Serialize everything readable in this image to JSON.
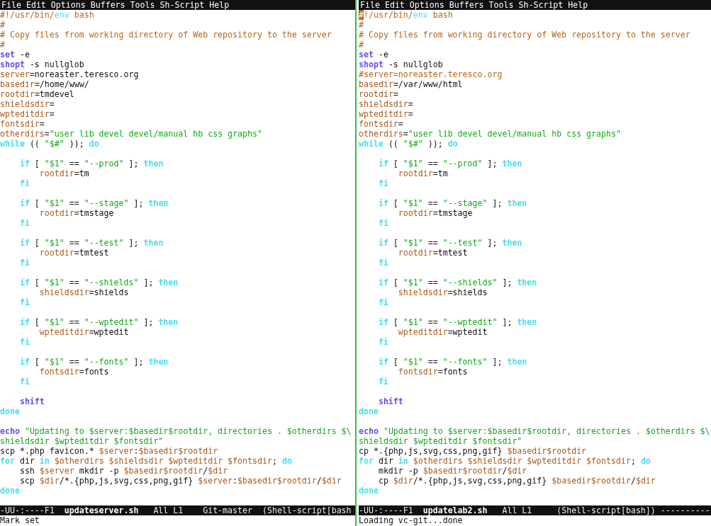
{
  "panes": [
    {
      "menu": [
        "File",
        "Edit",
        "Options",
        "Buffers",
        "Tools",
        "Sh-Script",
        "Help"
      ],
      "lines": [
        {
          "kind": "flush",
          "tokens": [
            {
              "kind": "comment",
              "text": "#!/usr/bin/"
            },
            {
              "kind": "function",
              "text": "env"
            },
            {
              "kind": "comment",
              "text": " bash"
            }
          ]
        },
        {
          "kind": "flush",
          "tokens": [
            {
              "kind": "comment",
              "text": "#"
            }
          ]
        },
        {
          "kind": "flush",
          "tokens": [
            {
              "kind": "comment",
              "text": "# Copy files from working directory of Web repository to the server"
            }
          ]
        },
        {
          "kind": "flush",
          "tokens": [
            {
              "kind": "comment",
              "text": "#"
            }
          ]
        },
        {
          "kind": "flush",
          "tokens": [
            {
              "kind": "builtin",
              "text": "set"
            },
            {
              "kind": "plain",
              "text": " -e"
            }
          ]
        },
        {
          "kind": "flush",
          "tokens": [
            {
              "kind": "builtin",
              "text": "shopt"
            },
            {
              "kind": "plain",
              "text": " -s nullglob"
            }
          ]
        },
        {
          "kind": "flush",
          "tokens": [
            {
              "kind": "variable",
              "text": "server"
            },
            {
              "kind": "plain",
              "text": "=noreaster.teresco.org"
            }
          ]
        },
        {
          "kind": "flush",
          "tokens": [
            {
              "kind": "variable",
              "text": "basedir"
            },
            {
              "kind": "plain",
              "text": "=/home/www/"
            }
          ]
        },
        {
          "kind": "flush",
          "tokens": [
            {
              "kind": "variable",
              "text": "rootdir"
            },
            {
              "kind": "plain",
              "text": "=tmdevel"
            }
          ]
        },
        {
          "kind": "flush",
          "tokens": [
            {
              "kind": "variable",
              "text": "shieldsdir"
            },
            {
              "kind": "plain",
              "text": "="
            }
          ]
        },
        {
          "kind": "flush",
          "tokens": [
            {
              "kind": "variable",
              "text": "wpteditdir"
            },
            {
              "kind": "plain",
              "text": "="
            }
          ]
        },
        {
          "kind": "flush",
          "tokens": [
            {
              "kind": "variable",
              "text": "fontsdir"
            },
            {
              "kind": "plain",
              "text": "="
            }
          ]
        },
        {
          "kind": "flush",
          "tokens": [
            {
              "kind": "variable",
              "text": "otherdirs"
            },
            {
              "kind": "plain",
              "text": "="
            },
            {
              "kind": "string",
              "text": "\"user lib devel devel/manual hb css graphs\""
            }
          ]
        },
        {
          "kind": "flush",
          "tokens": [
            {
              "kind": "keyword",
              "text": "while"
            },
            {
              "kind": "plain",
              "text": " (( "
            },
            {
              "kind": "string",
              "text": "\"$#\""
            },
            {
              "kind": "plain",
              "text": " )); "
            },
            {
              "kind": "keyword",
              "text": "do"
            }
          ]
        },
        {
          "kind": "blank"
        },
        {
          "kind": "inner",
          "tokens": [
            {
              "kind": "keyword",
              "text": "if"
            },
            {
              "kind": "plain",
              "text": " [ "
            },
            {
              "kind": "string",
              "text": "\"$1\""
            },
            {
              "kind": "plain",
              "text": " == "
            },
            {
              "kind": "string",
              "text": "\"--prod\""
            },
            {
              "kind": "plain",
              "text": " ]; "
            },
            {
              "kind": "keyword",
              "text": "then"
            }
          ]
        },
        {
          "kind": "deep",
          "tokens": [
            {
              "kind": "variable",
              "text": "rootdir"
            },
            {
              "kind": "plain",
              "text": "=tm"
            }
          ]
        },
        {
          "kind": "inner",
          "tokens": [
            {
              "kind": "keyword",
              "text": "fi"
            }
          ]
        },
        {
          "kind": "blank"
        },
        {
          "kind": "inner",
          "tokens": [
            {
              "kind": "keyword",
              "text": "if"
            },
            {
              "kind": "plain",
              "text": " [ "
            },
            {
              "kind": "string",
              "text": "\"$1\""
            },
            {
              "kind": "plain",
              "text": " == "
            },
            {
              "kind": "string",
              "text": "\"--stage\""
            },
            {
              "kind": "plain",
              "text": " ]; "
            },
            {
              "kind": "keyword",
              "text": "then"
            }
          ]
        },
        {
          "kind": "deep",
          "tokens": [
            {
              "kind": "variable",
              "text": "rootdir"
            },
            {
              "kind": "plain",
              "text": "=tmstage"
            }
          ]
        },
        {
          "kind": "inner",
          "tokens": [
            {
              "kind": "keyword",
              "text": "fi"
            }
          ]
        },
        {
          "kind": "blank"
        },
        {
          "kind": "inner",
          "tokens": [
            {
              "kind": "keyword",
              "text": "if"
            },
            {
              "kind": "plain",
              "text": " [ "
            },
            {
              "kind": "string",
              "text": "\"$1\""
            },
            {
              "kind": "plain",
              "text": " == "
            },
            {
              "kind": "string",
              "text": "\"--test\""
            },
            {
              "kind": "plain",
              "text": " ]; "
            },
            {
              "kind": "keyword",
              "text": "then"
            }
          ]
        },
        {
          "kind": "deep",
          "tokens": [
            {
              "kind": "variable",
              "text": "rootdir"
            },
            {
              "kind": "plain",
              "text": "=tmtest"
            }
          ]
        },
        {
          "kind": "inner",
          "tokens": [
            {
              "kind": "keyword",
              "text": "fi"
            }
          ]
        },
        {
          "kind": "blank"
        },
        {
          "kind": "inner",
          "tokens": [
            {
              "kind": "keyword",
              "text": "if"
            },
            {
              "kind": "plain",
              "text": " [ "
            },
            {
              "kind": "string",
              "text": "\"$1\""
            },
            {
              "kind": "plain",
              "text": " == "
            },
            {
              "kind": "string",
              "text": "\"--shields\""
            },
            {
              "kind": "plain",
              "text": " ]; "
            },
            {
              "kind": "keyword",
              "text": "then"
            }
          ]
        },
        {
          "kind": "deep",
          "tokens": [
            {
              "kind": "variable",
              "text": "shieldsdir"
            },
            {
              "kind": "plain",
              "text": "=shields"
            }
          ]
        },
        {
          "kind": "inner",
          "tokens": [
            {
              "kind": "keyword",
              "text": "fi"
            }
          ]
        },
        {
          "kind": "blank"
        },
        {
          "kind": "inner",
          "tokens": [
            {
              "kind": "keyword",
              "text": "if"
            },
            {
              "kind": "plain",
              "text": " [ "
            },
            {
              "kind": "string",
              "text": "\"$1\""
            },
            {
              "kind": "plain",
              "text": " == "
            },
            {
              "kind": "string",
              "text": "\"--wptedit\""
            },
            {
              "kind": "plain",
              "text": " ]; "
            },
            {
              "kind": "keyword",
              "text": "then"
            }
          ]
        },
        {
          "kind": "deep",
          "tokens": [
            {
              "kind": "variable",
              "text": "wpteditdir"
            },
            {
              "kind": "plain",
              "text": "=wptedit"
            }
          ]
        },
        {
          "kind": "inner",
          "tokens": [
            {
              "kind": "keyword",
              "text": "fi"
            }
          ]
        },
        {
          "kind": "blank"
        },
        {
          "kind": "inner",
          "tokens": [
            {
              "kind": "keyword",
              "text": "if"
            },
            {
              "kind": "plain",
              "text": " [ "
            },
            {
              "kind": "string",
              "text": "\"$1\""
            },
            {
              "kind": "plain",
              "text": " == "
            },
            {
              "kind": "string",
              "text": "\"--fonts\""
            },
            {
              "kind": "plain",
              "text": " ]; "
            },
            {
              "kind": "keyword",
              "text": "then"
            }
          ]
        },
        {
          "kind": "deep",
          "tokens": [
            {
              "kind": "variable",
              "text": "fontsdir"
            },
            {
              "kind": "plain",
              "text": "=fonts"
            }
          ]
        },
        {
          "kind": "inner",
          "tokens": [
            {
              "kind": "keyword",
              "text": "fi"
            }
          ]
        },
        {
          "kind": "blank"
        },
        {
          "kind": "inner",
          "tokens": [
            {
              "kind": "builtin",
              "text": "shift"
            }
          ]
        },
        {
          "kind": "flush",
          "tokens": [
            {
              "kind": "keyword",
              "text": "done"
            }
          ]
        },
        {
          "kind": "blank"
        },
        {
          "kind": "flush",
          "tokens": [
            {
              "kind": "builtin",
              "text": "echo"
            },
            {
              "kind": "string",
              "text": " \"Updating to $server:$basedir$rootdir, directories . $otherdirs $\\"
            }
          ]
        },
        {
          "kind": "flush",
          "tokens": [
            {
              "kind": "string",
              "text": "shieldsdir $wpteditdir $fontsdir\""
            }
          ]
        },
        {
          "kind": "flush",
          "tokens": [
            {
              "kind": "plain",
              "text": "scp *.php favicon.* "
            },
            {
              "kind": "variable",
              "text": "$server"
            },
            {
              "kind": "plain",
              "text": ":"
            },
            {
              "kind": "variable",
              "text": "$basedir$rootdir"
            }
          ]
        },
        {
          "kind": "flush",
          "tokens": [
            {
              "kind": "keyword",
              "text": "for"
            },
            {
              "kind": "plain",
              "text": " dir "
            },
            {
              "kind": "keyword",
              "text": "in"
            },
            {
              "kind": "variable",
              "text": " $otherdirs $shieldsdir $wpteditdir $fontsdir"
            },
            {
              "kind": "plain",
              "text": "; "
            },
            {
              "kind": "keyword",
              "text": "do"
            }
          ]
        },
        {
          "kind": "inner",
          "tokens": [
            {
              "kind": "plain",
              "text": "ssh "
            },
            {
              "kind": "variable",
              "text": "$server"
            },
            {
              "kind": "plain",
              "text": " mkdir -p "
            },
            {
              "kind": "variable",
              "text": "$basedir$rootdir"
            },
            {
              "kind": "plain",
              "text": "/"
            },
            {
              "kind": "variable",
              "text": "$dir"
            }
          ]
        },
        {
          "kind": "inner",
          "tokens": [
            {
              "kind": "plain",
              "text": "scp "
            },
            {
              "kind": "variable",
              "text": "$dir"
            },
            {
              "kind": "plain",
              "text": "/*.{php,js,svg,css,png,gif} "
            },
            {
              "kind": "variable",
              "text": "$server"
            },
            {
              "kind": "plain",
              "text": ":"
            },
            {
              "kind": "variable",
              "text": "$basedir$rootdir"
            },
            {
              "kind": "plain",
              "text": "/"
            },
            {
              "kind": "variable",
              "text": "$dir"
            }
          ]
        },
        {
          "kind": "flush",
          "tokens": [
            {
              "kind": "keyword",
              "text": "done"
            }
          ]
        },
        {
          "kind": "blank"
        }
      ],
      "mode_line": {
        "status": "-UU-:----F1",
        "buffer": "updateserver.sh",
        "position": "All L1",
        "vc": "Git-master",
        "mode": "(Shell-script[bash"
      },
      "echo_area": "Mark set"
    },
    {
      "menu": [
        "File",
        "Edit",
        "Options",
        "Buffers",
        "Tools",
        "Sh-Script",
        "Help"
      ],
      "lines": [
        {
          "kind": "flush",
          "tokens": [
            {
              "kind": "cursor",
              "text": "#"
            },
            {
              "kind": "comment",
              "text": "!/usr/bin/"
            },
            {
              "kind": "function",
              "text": "env"
            },
            {
              "kind": "comment",
              "text": " bash"
            }
          ]
        },
        {
          "kind": "flush",
          "tokens": [
            {
              "kind": "comment",
              "text": "#"
            }
          ]
        },
        {
          "kind": "flush",
          "tokens": [
            {
              "kind": "comment",
              "text": "# Copy files from working directory of Web repository to the server"
            }
          ]
        },
        {
          "kind": "flush",
          "tokens": [
            {
              "kind": "comment",
              "text": "#"
            }
          ]
        },
        {
          "kind": "flush",
          "tokens": [
            {
              "kind": "builtin",
              "text": "set"
            },
            {
              "kind": "plain",
              "text": " -e"
            }
          ]
        },
        {
          "kind": "flush",
          "tokens": [
            {
              "kind": "builtin",
              "text": "shopt"
            },
            {
              "kind": "plain",
              "text": " -s nullglob"
            }
          ]
        },
        {
          "kind": "flush",
          "tokens": [
            {
              "kind": "comment",
              "text": "#server=noreaster.teresco.org"
            }
          ]
        },
        {
          "kind": "flush",
          "tokens": [
            {
              "kind": "variable",
              "text": "basedir"
            },
            {
              "kind": "plain",
              "text": "=/var/www/html"
            }
          ]
        },
        {
          "kind": "flush",
          "tokens": [
            {
              "kind": "variable",
              "text": "rootdir"
            },
            {
              "kind": "plain",
              "text": "="
            }
          ]
        },
        {
          "kind": "flush",
          "tokens": [
            {
              "kind": "variable",
              "text": "shieldsdir"
            },
            {
              "kind": "plain",
              "text": "="
            }
          ]
        },
        {
          "kind": "flush",
          "tokens": [
            {
              "kind": "variable",
              "text": "wpteditdir"
            },
            {
              "kind": "plain",
              "text": "="
            }
          ]
        },
        {
          "kind": "flush",
          "tokens": [
            {
              "kind": "variable",
              "text": "fontsdir"
            },
            {
              "kind": "plain",
              "text": "="
            }
          ]
        },
        {
          "kind": "flush",
          "tokens": [
            {
              "kind": "variable",
              "text": "otherdirs"
            },
            {
              "kind": "plain",
              "text": "="
            },
            {
              "kind": "string",
              "text": "\"user lib devel devel/manual hb css graphs\""
            }
          ]
        },
        {
          "kind": "flush",
          "tokens": [
            {
              "kind": "keyword",
              "text": "while"
            },
            {
              "kind": "plain",
              "text": " (( "
            },
            {
              "kind": "string",
              "text": "\"$#\""
            },
            {
              "kind": "plain",
              "text": " )); "
            },
            {
              "kind": "keyword",
              "text": "do"
            }
          ]
        },
        {
          "kind": "blank"
        },
        {
          "kind": "inner",
          "tokens": [
            {
              "kind": "keyword",
              "text": "if"
            },
            {
              "kind": "plain",
              "text": " [ "
            },
            {
              "kind": "string",
              "text": "\"$1\""
            },
            {
              "kind": "plain",
              "text": " == "
            },
            {
              "kind": "string",
              "text": "\"--prod\""
            },
            {
              "kind": "plain",
              "text": " ]; "
            },
            {
              "kind": "keyword",
              "text": "then"
            }
          ]
        },
        {
          "kind": "deep",
          "tokens": [
            {
              "kind": "variable",
              "text": "rootdir"
            },
            {
              "kind": "plain",
              "text": "=tm"
            }
          ]
        },
        {
          "kind": "inner",
          "tokens": [
            {
              "kind": "keyword",
              "text": "fi"
            }
          ]
        },
        {
          "kind": "blank"
        },
        {
          "kind": "inner",
          "tokens": [
            {
              "kind": "keyword",
              "text": "if"
            },
            {
              "kind": "plain",
              "text": " [ "
            },
            {
              "kind": "string",
              "text": "\"$1\""
            },
            {
              "kind": "plain",
              "text": " == "
            },
            {
              "kind": "string",
              "text": "\"--stage\""
            },
            {
              "kind": "plain",
              "text": " ]; "
            },
            {
              "kind": "keyword",
              "text": "then"
            }
          ]
        },
        {
          "kind": "deep",
          "tokens": [
            {
              "kind": "variable",
              "text": "rootdir"
            },
            {
              "kind": "plain",
              "text": "=tmstage"
            }
          ]
        },
        {
          "kind": "inner",
          "tokens": [
            {
              "kind": "keyword",
              "text": "fi"
            }
          ]
        },
        {
          "kind": "blank"
        },
        {
          "kind": "inner",
          "tokens": [
            {
              "kind": "keyword",
              "text": "if"
            },
            {
              "kind": "plain",
              "text": " [ "
            },
            {
              "kind": "string",
              "text": "\"$1\""
            },
            {
              "kind": "plain",
              "text": " == "
            },
            {
              "kind": "string",
              "text": "\"--test\""
            },
            {
              "kind": "plain",
              "text": " ]; "
            },
            {
              "kind": "keyword",
              "text": "then"
            }
          ]
        },
        {
          "kind": "deep",
          "tokens": [
            {
              "kind": "variable",
              "text": "rootdir"
            },
            {
              "kind": "plain",
              "text": "=tmtest"
            }
          ]
        },
        {
          "kind": "inner",
          "tokens": [
            {
              "kind": "keyword",
              "text": "fi"
            }
          ]
        },
        {
          "kind": "blank"
        },
        {
          "kind": "inner",
          "tokens": [
            {
              "kind": "keyword",
              "text": "if"
            },
            {
              "kind": "plain",
              "text": " [ "
            },
            {
              "kind": "string",
              "text": "\"$1\""
            },
            {
              "kind": "plain",
              "text": " == "
            },
            {
              "kind": "string",
              "text": "\"--shields\""
            },
            {
              "kind": "plain",
              "text": " ]; "
            },
            {
              "kind": "keyword",
              "text": "then"
            }
          ]
        },
        {
          "kind": "deep",
          "tokens": [
            {
              "kind": "variable",
              "text": "shieldsdir"
            },
            {
              "kind": "plain",
              "text": "=shields"
            }
          ]
        },
        {
          "kind": "inner",
          "tokens": [
            {
              "kind": "keyword",
              "text": "fi"
            }
          ]
        },
        {
          "kind": "blank"
        },
        {
          "kind": "inner",
          "tokens": [
            {
              "kind": "keyword",
              "text": "if"
            },
            {
              "kind": "plain",
              "text": " [ "
            },
            {
              "kind": "string",
              "text": "\"$1\""
            },
            {
              "kind": "plain",
              "text": " == "
            },
            {
              "kind": "string",
              "text": "\"--wptedit\""
            },
            {
              "kind": "plain",
              "text": " ]; "
            },
            {
              "kind": "keyword",
              "text": "then"
            }
          ]
        },
        {
          "kind": "deep",
          "tokens": [
            {
              "kind": "variable",
              "text": "wpteditdir"
            },
            {
              "kind": "plain",
              "text": "=wptedit"
            }
          ]
        },
        {
          "kind": "inner",
          "tokens": [
            {
              "kind": "keyword",
              "text": "fi"
            }
          ]
        },
        {
          "kind": "blank"
        },
        {
          "kind": "inner",
          "tokens": [
            {
              "kind": "keyword",
              "text": "if"
            },
            {
              "kind": "plain",
              "text": " [ "
            },
            {
              "kind": "string",
              "text": "\"$1\""
            },
            {
              "kind": "plain",
              "text": " == "
            },
            {
              "kind": "string",
              "text": "\"--fonts\""
            },
            {
              "kind": "plain",
              "text": " ]; "
            },
            {
              "kind": "keyword",
              "text": "then"
            }
          ]
        },
        {
          "kind": "deep",
          "tokens": [
            {
              "kind": "variable",
              "text": "fontsdir"
            },
            {
              "kind": "plain",
              "text": "=fonts"
            }
          ]
        },
        {
          "kind": "inner",
          "tokens": [
            {
              "kind": "keyword",
              "text": "fi"
            }
          ]
        },
        {
          "kind": "blank"
        },
        {
          "kind": "inner",
          "tokens": [
            {
              "kind": "builtin",
              "text": "shift"
            }
          ]
        },
        {
          "kind": "flush",
          "tokens": [
            {
              "kind": "keyword",
              "text": "done"
            }
          ]
        },
        {
          "kind": "blank"
        },
        {
          "kind": "flush",
          "tokens": [
            {
              "kind": "builtin",
              "text": "echo"
            },
            {
              "kind": "string",
              "text": " \"Updating to $server:$basedir$rootdir, directories . $otherdirs $\\"
            }
          ]
        },
        {
          "kind": "flush",
          "tokens": [
            {
              "kind": "string",
              "text": "shieldsdir $wpteditdir $fontsdir\""
            }
          ]
        },
        {
          "kind": "flush",
          "tokens": [
            {
              "kind": "plain",
              "text": "cp *.{php,js,svg,css,png,gif} "
            },
            {
              "kind": "variable",
              "text": "$basedir$rootdir"
            }
          ]
        },
        {
          "kind": "flush",
          "tokens": [
            {
              "kind": "keyword",
              "text": "for"
            },
            {
              "kind": "plain",
              "text": " dir "
            },
            {
              "kind": "keyword",
              "text": "in"
            },
            {
              "kind": "variable",
              "text": " $otherdirs $shieldsdir $wpteditdir $fontsdir"
            },
            {
              "kind": "plain",
              "text": "; "
            },
            {
              "kind": "keyword",
              "text": "do"
            }
          ]
        },
        {
          "kind": "inner",
          "tokens": [
            {
              "kind": "plain",
              "text": "mkdir -p "
            },
            {
              "kind": "variable",
              "text": "$basedir$rootdir"
            },
            {
              "kind": "plain",
              "text": "/"
            },
            {
              "kind": "variable",
              "text": "$dir"
            }
          ]
        },
        {
          "kind": "inner",
          "tokens": [
            {
              "kind": "plain",
              "text": "cp "
            },
            {
              "kind": "variable",
              "text": "$dir"
            },
            {
              "kind": "plain",
              "text": "/*.{php,js,svg,css,png,gif} "
            },
            {
              "kind": "variable",
              "text": "$basedir$rootdir"
            },
            {
              "kind": "plain",
              "text": "/"
            },
            {
              "kind": "variable",
              "text": "$dir"
            }
          ]
        },
        {
          "kind": "flush",
          "tokens": [
            {
              "kind": "keyword",
              "text": "done"
            }
          ]
        },
        {
          "kind": "blank"
        }
      ],
      "mode_line": {
        "status": "-UU-:----F1",
        "buffer": "updatelab2.sh",
        "position": "All L1",
        "mode": "(Shell-script[bash]) ----------"
      },
      "echo_area": "Loading vc-git...done"
    }
  ]
}
